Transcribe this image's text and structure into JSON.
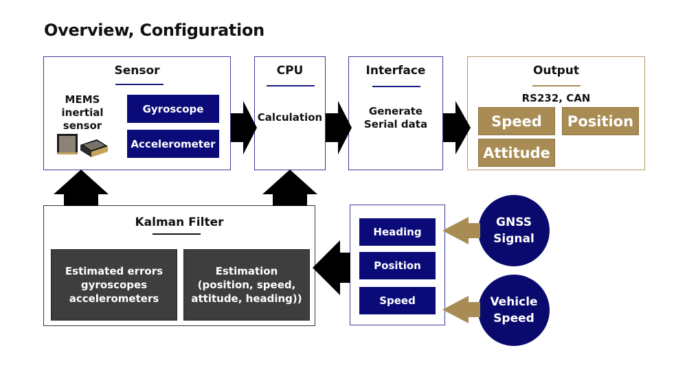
{
  "title": "Overview, Configuration",
  "colors": {
    "navy": "#0a0a78",
    "gold": "#a88c54",
    "dark_gray": "#3e3e3e",
    "box_border_blue": "#3a3a9a",
    "box_border_gold": "#b39a68",
    "arrow_black": "#000000"
  },
  "sensor": {
    "title": "Sensor",
    "mems_label": "MEMS\ninertial\nsensor",
    "image": "mems-chip-images",
    "items": [
      "Gyroscope",
      "Accelerometer"
    ]
  },
  "cpu": {
    "title": "CPU",
    "body": "Calculation"
  },
  "interface": {
    "title": "Interface",
    "body": "Generate\nSerial data"
  },
  "output": {
    "title": "Output",
    "subtitle": "RS232, CAN",
    "items": [
      "Speed",
      "Position",
      "Attitude"
    ]
  },
  "kalman": {
    "title": "Kalman Filter",
    "blocks": [
      "Estimated errors\ngyroscopes\naccelerometers",
      "Estimation\n (position, speed,\nattitude, heading))"
    ]
  },
  "inputs": {
    "items": [
      "Heading",
      "Position",
      "Speed"
    ]
  },
  "sources": [
    {
      "label": "GNSS\nSignal"
    },
    {
      "label": "Vehicle\nSpeed"
    }
  ],
  "arrows": [
    {
      "from": "sensor",
      "to": "cpu",
      "direction": "right",
      "color": "black"
    },
    {
      "from": "cpu",
      "to": "interface",
      "direction": "right",
      "color": "black"
    },
    {
      "from": "interface",
      "to": "output",
      "direction": "right",
      "color": "black"
    },
    {
      "from": "kalman",
      "to": "sensor",
      "direction": "up",
      "color": "black"
    },
    {
      "from": "kalman",
      "to": "cpu",
      "direction": "up",
      "color": "black"
    },
    {
      "from": "inputs",
      "to": "kalman",
      "direction": "left",
      "color": "black"
    },
    {
      "from": "gnss",
      "to": "heading",
      "direction": "left",
      "color": "gold"
    },
    {
      "from": "vehicle-speed",
      "to": "speed",
      "direction": "left",
      "color": "gold"
    }
  ]
}
